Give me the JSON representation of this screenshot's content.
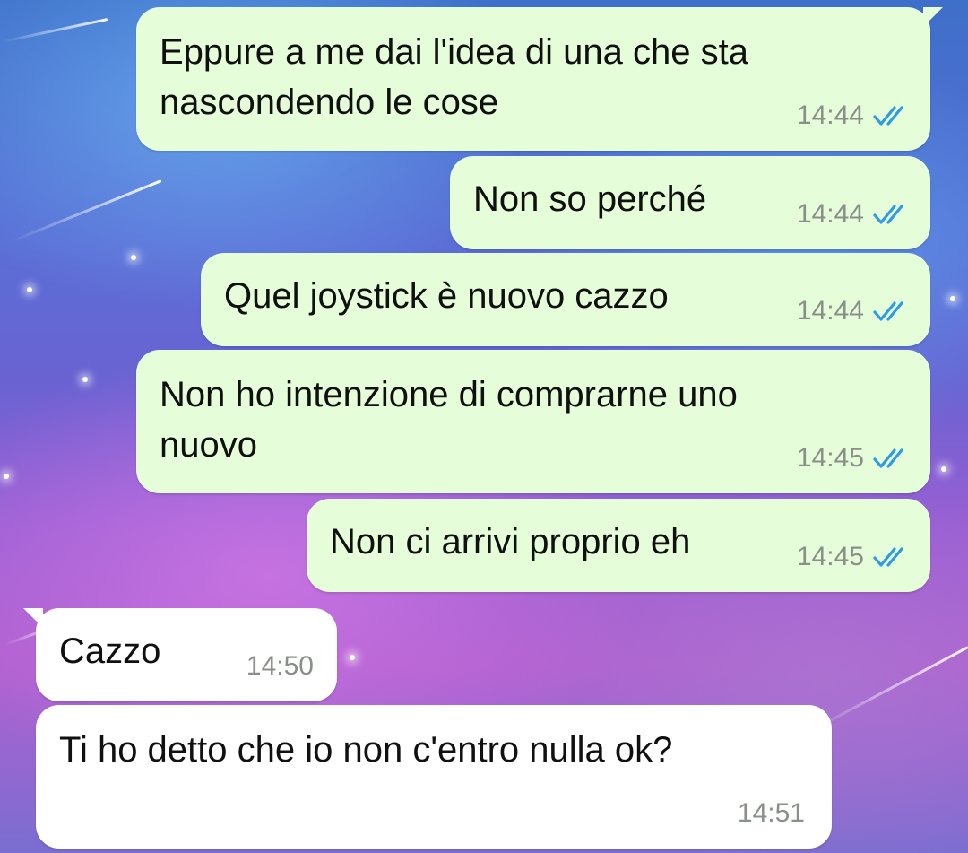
{
  "messages": [
    {
      "text": "Eppure a me dai l'idea di una che sta\nnascondendo le cose",
      "time": "14:44",
      "direction": "outgoing",
      "status": "read"
    },
    {
      "text": "Non so perché",
      "time": "14:44",
      "direction": "outgoing",
      "status": "read"
    },
    {
      "text": "Quel joystick è nuovo cazzo",
      "time": "14:44",
      "direction": "outgoing",
      "status": "read"
    },
    {
      "text": "Non ho intenzione di comprarne uno\nnuovo",
      "time": "14:45",
      "direction": "outgoing",
      "status": "read"
    },
    {
      "text": "Non ci arrivi proprio eh",
      "time": "14:45",
      "direction": "outgoing",
      "status": "read"
    },
    {
      "text": "Cazzo",
      "time": "14:50",
      "direction": "incoming"
    },
    {
      "text": "Ti ho detto che io non c'entro nulla ok?",
      "time": "14:51",
      "direction": "incoming"
    }
  ],
  "colors": {
    "outgoing_bubble": "#e6fdd9",
    "incoming_bubble": "#ffffff",
    "read_ticks": "#2f9be0",
    "timestamp": "#8a8f8a"
  },
  "icons": {
    "read_receipt": "double-check-icon"
  }
}
